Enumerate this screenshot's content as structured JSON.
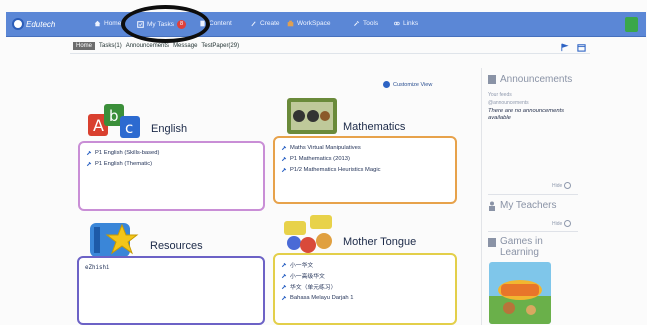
{
  "nav": {
    "logo_text": "Edutech",
    "items": [
      {
        "label": "Home",
        "icon": "home-icon"
      },
      {
        "label": "My Tasks",
        "icon": "tasks-icon",
        "badge": "8"
      },
      {
        "label": "Content",
        "icon": "content-icon"
      },
      {
        "label": "Create",
        "icon": "pencil-icon"
      },
      {
        "label": "WorkSpace",
        "icon": "workspace-icon"
      },
      {
        "label": "Tools",
        "icon": "tools-icon"
      },
      {
        "label": "Links",
        "icon": "links-icon"
      }
    ]
  },
  "subtabs": [
    "Home",
    "Tasks(1)",
    "Announcements",
    "Message",
    "TestPaper(29)"
  ],
  "customize_label": "Customize View",
  "subjects": [
    {
      "title": "English",
      "items": [
        "P1 English (Skills-based)",
        "P1 English (Thematic)"
      ]
    },
    {
      "title": "Mathematics",
      "items": [
        "Maths Virtual Manipulatives",
        "P1 Mathematics (2013)",
        "P1/2 Mathematics Heuristics Magic"
      ]
    },
    {
      "title": "Resources",
      "items": [
        "eZhishi"
      ]
    },
    {
      "title": "Mother Tongue",
      "items": [
        "小一华文",
        "小一高级华文",
        "华文（单元练习）",
        "Bahasa Melayu Darjah 1"
      ]
    }
  ],
  "sidebar": {
    "announcements_title": "Announcements",
    "announcements_meta1": "Your feeds",
    "announcements_meta2": "@announcements",
    "announcements_empty": "There are no announcements available",
    "hide_label": "Hide",
    "teachers_title": "My Teachers",
    "games_title": "Games in Learning"
  },
  "colors": {
    "nav_bg": "#5b87d6",
    "english_border": "#c98ed6",
    "maths_border": "#e7a24b",
    "resources_border": "#6c62c6",
    "mother_tongue_border": "#e3cf4a"
  }
}
